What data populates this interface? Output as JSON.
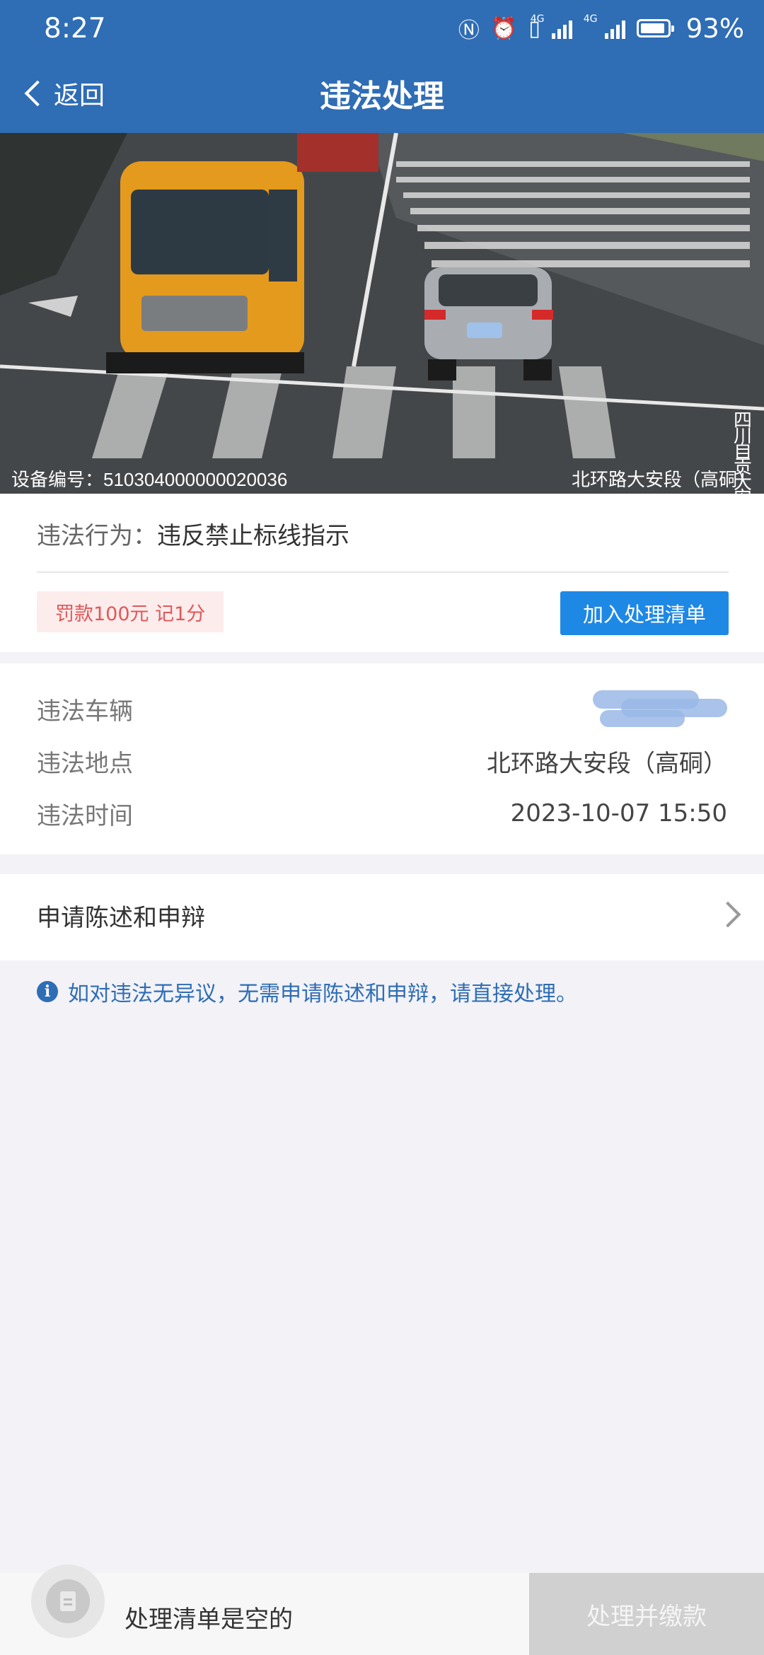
{
  "status_bar": {
    "time": "8:27",
    "network_label": "4G",
    "battery_percent": "93%",
    "battery_level": 0.93
  },
  "nav": {
    "back_label": "返回",
    "title": "违法处理"
  },
  "photo": {
    "device_id": "设备编号：510304000000020036",
    "location": "北环路大安段（高硐）",
    "stamp": "四川自贡大安"
  },
  "violation": {
    "behavior_key": "违法行为：",
    "behavior_value": "违反禁止标线指示",
    "penalty": "罚款100元 记1分",
    "add_button": "加入处理清单"
  },
  "details": [
    {
      "key": "违法车辆",
      "value": ""
    },
    {
      "key": "违法地点",
      "value": "北环路大安段（高硐）"
    },
    {
      "key": "违法时间",
      "value": "2023-10-07 15:50"
    }
  ],
  "appeal": {
    "label": "申请陈述和申辩"
  },
  "notice": "如对违法无异议，无需申请陈述和申辩，请直接处理。",
  "bottom": {
    "cart_text": "处理清单是空的",
    "pay_button": "处理并缴款"
  },
  "colors": {
    "brand": "#2f6db5",
    "button": "#1e88e5",
    "penalty": "#e05858"
  }
}
